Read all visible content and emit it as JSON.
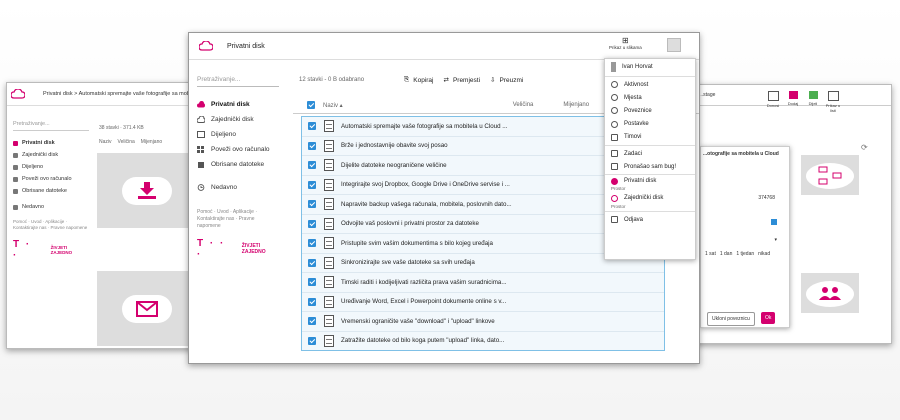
{
  "left_window": {
    "breadcrumb": "Privatni disk > Automatski spremajte vaše fotografije sa mobitela u",
    "search_placeholder": "Pretraživanje...",
    "stats": "38 stavki · 371.4 KB",
    "col_name": "Naziv",
    "col_size": "Veličina",
    "col_modified": "Mijenjano",
    "nav": [
      "Privatni disk",
      "Zajednički disk",
      "Dijeljeno",
      "Poveži ovo računalo",
      "Obrisane datoteke",
      "Nedavno"
    ],
    "footer": "Pomoć · Uvod · Aplikacije · Kontaktirajte nas · Pravne napomene",
    "logo_text": "T · ·",
    "slogan": "ŽIVJETI ZAJEDNO"
  },
  "main_window": {
    "title": "Privatni disk",
    "view_label": "Prikaz u slikama",
    "search_placeholder": "Pretraživanje...",
    "nav": [
      {
        "label": "Privatni disk",
        "icon": "cloud-icon"
      },
      {
        "label": "Zajednički disk",
        "icon": "cloud-shared-icon"
      },
      {
        "label": "Dijeljeno",
        "icon": "share-icon"
      },
      {
        "label": "Poveži ovo računalo",
        "icon": "grid-icon"
      },
      {
        "label": "Obrisane datoteke",
        "icon": "trash-icon"
      },
      {
        "label": "Nedavno",
        "icon": "clock-icon"
      }
    ],
    "footer": "Pomoć · Uvod · Aplikacije · Kontaktirajte nas · Pravne napomene",
    "logo_text": "T · · ·",
    "slogan": "ŽIVJETI ZAJEDNO",
    "selection_info": "12 stavki - 0 B odabrano",
    "toolbar": {
      "copy": "Kopiraj",
      "move": "Premjesti",
      "rename": "Preuzmi"
    },
    "columns": {
      "name": "Naziv",
      "size": "Veličina",
      "modified": "Mijenjano"
    },
    "files": [
      "Automatski spremajte vaše fotografije sa mobitela u Cloud ...",
      "Brže i jednostavnije obavite svoj posao",
      "Dijelite datoteke neograničene veličine",
      "Integrirajte svoj Dropbox, Google Drive i OneDrive servise i ...",
      "Napravite backup vašega računala, mobitela, poslovnih dato...",
      "Odvojite vaš poslovni i privatni prostor za datoteke",
      "Pristupite svim vašim dokumentima s bilo kojeg uređaja",
      "Sinkronizirajte sve vaše datoteke sa svih uređaja",
      "Timski raditi i kodijeljivati različita prava vašim suradnicima...",
      "Uređivanje Word, Excel i Powerpoint dokumente online s v...",
      "Vremenski ograničite vaše \"download\" i \"upload\" linkove",
      "Zatražite datoteke od bilo koga putem \"upload\" linka, dato..."
    ]
  },
  "menu": {
    "user": "Ivan Horvat",
    "items": [
      {
        "label": "Aktivnost",
        "icon": "activity-icon"
      },
      {
        "label": "Mjesta",
        "icon": "pin-icon"
      },
      {
        "label": "Poveznice",
        "icon": "link-icon"
      },
      {
        "label": "Postavke",
        "icon": "gear-icon"
      },
      {
        "label": "Timovi",
        "icon": "team-icon"
      }
    ],
    "items2": [
      {
        "label": "Zadaci",
        "icon": "tasks-icon"
      },
      {
        "label": "Pronašao sam bug!",
        "icon": "bug-icon"
      }
    ],
    "space_private": "Privatni disk",
    "space_private_sub": "Prostor",
    "space_shared": "Zajednički disk",
    "space_shared_sub": "Prostor",
    "logout": "Odjava"
  },
  "right_window": {
    "title": "...stage",
    "buttons": [
      "Donosi",
      "Dodaj",
      "Dijeli",
      "Prikaz u listi"
    ],
    "dialog_title": "...otografije sa mobitela u Cloud",
    "dialog_id": "374768",
    "time_options": [
      "1 sat",
      "1 dan",
      "1 tjedan",
      "nikad"
    ],
    "remove_link": "Ukloni poveznicu",
    "ok": "Ok"
  },
  "colors": {
    "accent": "#d4006e",
    "selection": "#2d8dd6",
    "list_bg": "#f2f8fc"
  }
}
